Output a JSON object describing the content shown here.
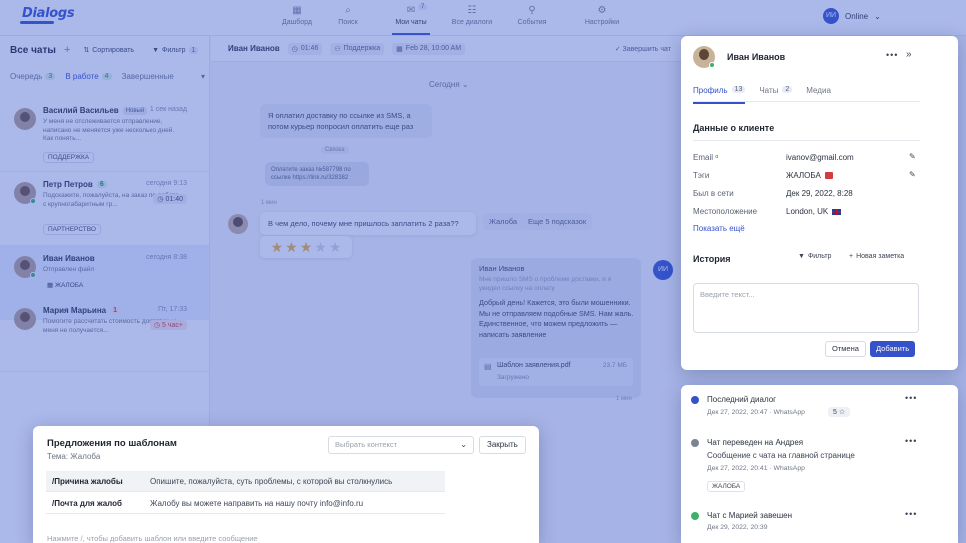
{
  "logo": "Dialogs",
  "nav": [
    {
      "label": "Дашборд",
      "icon": "dashboard-icon",
      "glyph": "▦"
    },
    {
      "label": "Поиск",
      "icon": "search-icon",
      "glyph": "⌕"
    },
    {
      "label": "Мои чаты",
      "icon": "chats-icon",
      "glyph": "✉",
      "badge": "7"
    },
    {
      "label": "Все диалоги",
      "icon": "dialogs-icon",
      "glyph": "☷"
    },
    {
      "label": "События",
      "icon": "events-icon",
      "glyph": "⚲"
    },
    {
      "label": "Настройки",
      "icon": "settings-icon",
      "glyph": "⚙"
    }
  ],
  "user": {
    "initials": "ИИ",
    "status": "Online"
  },
  "chats": {
    "title": "Все чаты",
    "sort": "Сортировать",
    "filter": "Фильтр",
    "filter_count": "1",
    "tabs": [
      {
        "label": "Очередь",
        "count": "3"
      },
      {
        "label": "В работе",
        "count": "4"
      },
      {
        "label": "Завершенные",
        "count": ""
      }
    ],
    "items": [
      {
        "name": "Василий Васильев",
        "badge": "Новый",
        "time": "1 сек назад",
        "preview": "У меня не отслеживается отправление, написано не меняется уже несколько дней. Как понять...",
        "tag": "ПОДДЕРЖКА"
      },
      {
        "name": "Петр Петров",
        "badge": "6",
        "time": "сегодня 9:13",
        "preview": "Подскажите, пожалуйста, на заказ по работе с крупногабаритным гр...",
        "tag": "ПАРТНЕРСТВО",
        "timer": "01:40"
      },
      {
        "name": "Иван Иванов",
        "badge": "",
        "time": "сегодня 8:38",
        "preview": "Отправлен файл",
        "tag": "ЖАЛОБА"
      },
      {
        "name": "Мария Марьина",
        "badge": "1",
        "time": "Пт, 17:33",
        "preview": "Помогите рассчитать стоимость доставки, у меня не получается...",
        "tag": "",
        "timer": "5 час+"
      }
    ]
  },
  "conversation": {
    "name": "Иван Иванов",
    "timer": "01:46",
    "support": "Поддержка",
    "date": "Feb 28, 10:00 AM",
    "finish": "Завершить чат",
    "day": "Сегодня",
    "msg1": "Я оплатил доставку по ссылке из SMS, а потом курьер попросил оплатить еще раз",
    "quote": "Оплатите заказ №587798 по ссылке https://link.ru/328382",
    "sep": "Связка",
    "msg2": "В чем дело, почему мне пришлось заплатить 2 раза??",
    "msg2_time": "1 мин",
    "rating": 3,
    "rating_max": 5,
    "quick1": "Жалоба",
    "quick2": "Еще 5 подсказок",
    "operator_name": "Иван Иванов",
    "operator_faded": "Мне пришло SMS о проблеме доставки, и я увидел ссылку на оплату",
    "operator_text": "Добрый день! Кажется, это были мошенники. Мы не отправляем подобные SMS. Нам жаль. Единственное, что можем предложить — написать заявление",
    "operator_initials": "ИИ",
    "file_name": "Шаблон заявления.pdf",
    "file_size": "23.7 МБ",
    "file_status": "Загружено",
    "file_time": "1 мин"
  },
  "profile": {
    "name": "Иван Иванов",
    "tabs": [
      {
        "label": "Профиль",
        "count": "13"
      },
      {
        "label": "Чаты",
        "count": "2"
      },
      {
        "label": "Медиа",
        "count": ""
      }
    ],
    "section": "Данные о клиенте",
    "fields": [
      {
        "label": "Email",
        "value": "ivanov@gmail.com"
      },
      {
        "label": "Тэги",
        "value": "ЖАЛОБА"
      },
      {
        "label": "Был в сети",
        "value": "Дек 29, 2022, 8:28"
      },
      {
        "label": "Местоположение",
        "value": "London, UK"
      }
    ],
    "more": "Показать ещё",
    "history_title": "История",
    "history_filter": "Фильтр",
    "new_note": "Новая заметка",
    "placeholder": "Введите текст...",
    "cancel": "Отмена",
    "add": "Добавить"
  },
  "history": [
    {
      "title": "Последний диалог",
      "meta": "Дек 27, 2022, 20:47 · WhatsApp",
      "badge": "5 ☆",
      "color": "#3552c9"
    },
    {
      "title": "Чат переведен на Андрея",
      "sub": "Сообщение с чата на главной странице",
      "meta": "Дек 27, 2022, 20:41 · WhatsApp",
      "tag": "ЖАЛОБА",
      "color": "#7c8494"
    },
    {
      "title": "Чат с Марией завешен",
      "meta": "Дек 29, 2022, 20:39",
      "color": "#3bb26a"
    }
  ],
  "templates": {
    "title": "Предложения по шаблонам",
    "subtitle": "Тема: Жалоба",
    "select_placeholder": "Выбрать контекст",
    "close": "Закрыть",
    "rows": [
      {
        "key": "/Причина жалобы",
        "value": "Опишите, пожалуйста, суть проблемы, с которой вы столкнулись"
      },
      {
        "key": "/Почта для жалоб",
        "value": "Жалобу вы можете направить на нашу почту info@info.ru"
      }
    ],
    "hint": "Нажмите /, чтобы добавить шаблон или введите сообщение"
  }
}
